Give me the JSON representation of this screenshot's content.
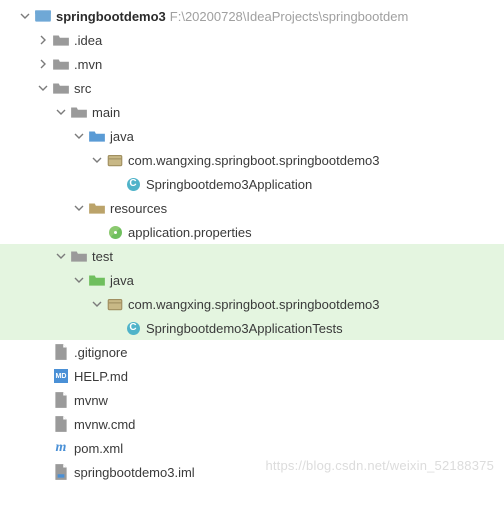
{
  "project": {
    "name": "springbootdemo3",
    "path": "F:\\20200728\\IdeaProjects\\springbootdem"
  },
  "tree": {
    "idea": ".idea",
    "mvn": ".mvn",
    "src": "src",
    "main": "main",
    "java_main": "java",
    "pkg_main": "com.wangxing.springboot.springbootdemo3",
    "class_main": "Springbootdemo3Application",
    "resources": "resources",
    "app_props": "application.properties",
    "test": "test",
    "java_test": "java",
    "pkg_test": "com.wangxing.springboot.springbootdemo3",
    "class_test": "Springbootdemo3ApplicationTests",
    "gitignore": ".gitignore",
    "help_md": "HELP.md",
    "mvnw": "mvnw",
    "mvnw_cmd": "mvnw.cmd",
    "pom": "pom.xml",
    "iml": "springbootdemo3.iml"
  },
  "watermark": "https://blog.csdn.net/weixin_52188375"
}
